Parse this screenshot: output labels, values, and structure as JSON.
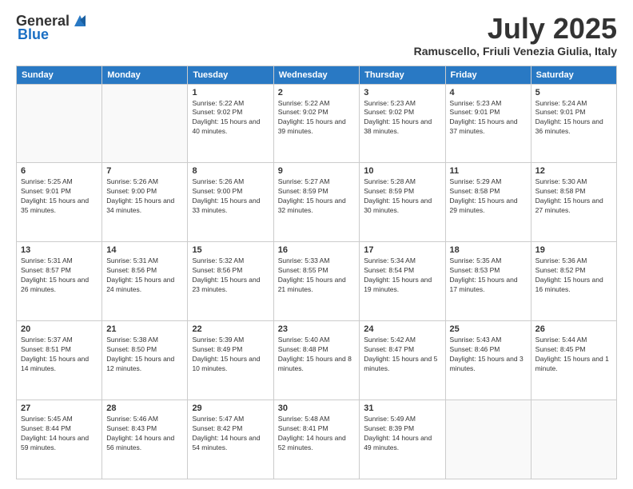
{
  "header": {
    "logo_general": "General",
    "logo_blue": "Blue",
    "month_title": "July 2025",
    "location": "Ramuscello, Friuli Venezia Giulia, Italy"
  },
  "days_of_week": [
    "Sunday",
    "Monday",
    "Tuesday",
    "Wednesday",
    "Thursday",
    "Friday",
    "Saturday"
  ],
  "weeks": [
    [
      {
        "day": "",
        "info": ""
      },
      {
        "day": "",
        "info": ""
      },
      {
        "day": "1",
        "info": "Sunrise: 5:22 AM\nSunset: 9:02 PM\nDaylight: 15 hours and 40 minutes."
      },
      {
        "day": "2",
        "info": "Sunrise: 5:22 AM\nSunset: 9:02 PM\nDaylight: 15 hours and 39 minutes."
      },
      {
        "day": "3",
        "info": "Sunrise: 5:23 AM\nSunset: 9:02 PM\nDaylight: 15 hours and 38 minutes."
      },
      {
        "day": "4",
        "info": "Sunrise: 5:23 AM\nSunset: 9:01 PM\nDaylight: 15 hours and 37 minutes."
      },
      {
        "day": "5",
        "info": "Sunrise: 5:24 AM\nSunset: 9:01 PM\nDaylight: 15 hours and 36 minutes."
      }
    ],
    [
      {
        "day": "6",
        "info": "Sunrise: 5:25 AM\nSunset: 9:01 PM\nDaylight: 15 hours and 35 minutes."
      },
      {
        "day": "7",
        "info": "Sunrise: 5:26 AM\nSunset: 9:00 PM\nDaylight: 15 hours and 34 minutes."
      },
      {
        "day": "8",
        "info": "Sunrise: 5:26 AM\nSunset: 9:00 PM\nDaylight: 15 hours and 33 minutes."
      },
      {
        "day": "9",
        "info": "Sunrise: 5:27 AM\nSunset: 8:59 PM\nDaylight: 15 hours and 32 minutes."
      },
      {
        "day": "10",
        "info": "Sunrise: 5:28 AM\nSunset: 8:59 PM\nDaylight: 15 hours and 30 minutes."
      },
      {
        "day": "11",
        "info": "Sunrise: 5:29 AM\nSunset: 8:58 PM\nDaylight: 15 hours and 29 minutes."
      },
      {
        "day": "12",
        "info": "Sunrise: 5:30 AM\nSunset: 8:58 PM\nDaylight: 15 hours and 27 minutes."
      }
    ],
    [
      {
        "day": "13",
        "info": "Sunrise: 5:31 AM\nSunset: 8:57 PM\nDaylight: 15 hours and 26 minutes."
      },
      {
        "day": "14",
        "info": "Sunrise: 5:31 AM\nSunset: 8:56 PM\nDaylight: 15 hours and 24 minutes."
      },
      {
        "day": "15",
        "info": "Sunrise: 5:32 AM\nSunset: 8:56 PM\nDaylight: 15 hours and 23 minutes."
      },
      {
        "day": "16",
        "info": "Sunrise: 5:33 AM\nSunset: 8:55 PM\nDaylight: 15 hours and 21 minutes."
      },
      {
        "day": "17",
        "info": "Sunrise: 5:34 AM\nSunset: 8:54 PM\nDaylight: 15 hours and 19 minutes."
      },
      {
        "day": "18",
        "info": "Sunrise: 5:35 AM\nSunset: 8:53 PM\nDaylight: 15 hours and 17 minutes."
      },
      {
        "day": "19",
        "info": "Sunrise: 5:36 AM\nSunset: 8:52 PM\nDaylight: 15 hours and 16 minutes."
      }
    ],
    [
      {
        "day": "20",
        "info": "Sunrise: 5:37 AM\nSunset: 8:51 PM\nDaylight: 15 hours and 14 minutes."
      },
      {
        "day": "21",
        "info": "Sunrise: 5:38 AM\nSunset: 8:50 PM\nDaylight: 15 hours and 12 minutes."
      },
      {
        "day": "22",
        "info": "Sunrise: 5:39 AM\nSunset: 8:49 PM\nDaylight: 15 hours and 10 minutes."
      },
      {
        "day": "23",
        "info": "Sunrise: 5:40 AM\nSunset: 8:48 PM\nDaylight: 15 hours and 8 minutes."
      },
      {
        "day": "24",
        "info": "Sunrise: 5:42 AM\nSunset: 8:47 PM\nDaylight: 15 hours and 5 minutes."
      },
      {
        "day": "25",
        "info": "Sunrise: 5:43 AM\nSunset: 8:46 PM\nDaylight: 15 hours and 3 minutes."
      },
      {
        "day": "26",
        "info": "Sunrise: 5:44 AM\nSunset: 8:45 PM\nDaylight: 15 hours and 1 minute."
      }
    ],
    [
      {
        "day": "27",
        "info": "Sunrise: 5:45 AM\nSunset: 8:44 PM\nDaylight: 14 hours and 59 minutes."
      },
      {
        "day": "28",
        "info": "Sunrise: 5:46 AM\nSunset: 8:43 PM\nDaylight: 14 hours and 56 minutes."
      },
      {
        "day": "29",
        "info": "Sunrise: 5:47 AM\nSunset: 8:42 PM\nDaylight: 14 hours and 54 minutes."
      },
      {
        "day": "30",
        "info": "Sunrise: 5:48 AM\nSunset: 8:41 PM\nDaylight: 14 hours and 52 minutes."
      },
      {
        "day": "31",
        "info": "Sunrise: 5:49 AM\nSunset: 8:39 PM\nDaylight: 14 hours and 49 minutes."
      },
      {
        "day": "",
        "info": ""
      },
      {
        "day": "",
        "info": ""
      }
    ]
  ]
}
